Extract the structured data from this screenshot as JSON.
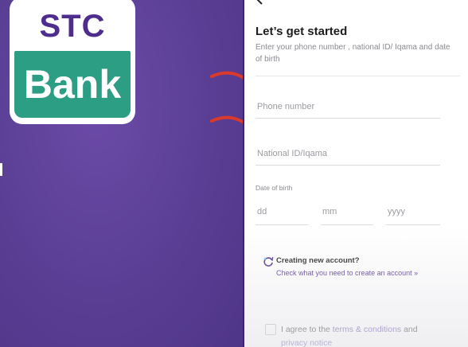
{
  "logo": {
    "line1": "STC",
    "line2": "Bank",
    "colors": {
      "purple": "#4f2d8f",
      "green": "#2b9e84",
      "white": "#ffffff"
    }
  },
  "screen": {
    "back_icon": "chevron-left-icon",
    "title": "Let’s get started",
    "subtitle": "Enter your phone number , national ID/ Iqama and date of birth",
    "phone_placeholder": "Phone number",
    "id_placeholder": "National ID/Iqama",
    "dob": {
      "label": "Date of birth",
      "dd_placeholder": "dd",
      "mm_placeholder": "mm",
      "yyyy_placeholder": "yyyy"
    },
    "info": {
      "icon": "refresh-icon",
      "title": "Creating new account?",
      "link": "Check what you need to create an account",
      "link_suffix": "»"
    },
    "agree": {
      "prefix": "I agree to the ",
      "terms": "terms & conditions",
      "middle": " and",
      "privacy": "privacy notice"
    }
  },
  "colors": {
    "background": "#5b3f96",
    "accent": "#4b2c8c",
    "arrow": "#d93a2b"
  }
}
